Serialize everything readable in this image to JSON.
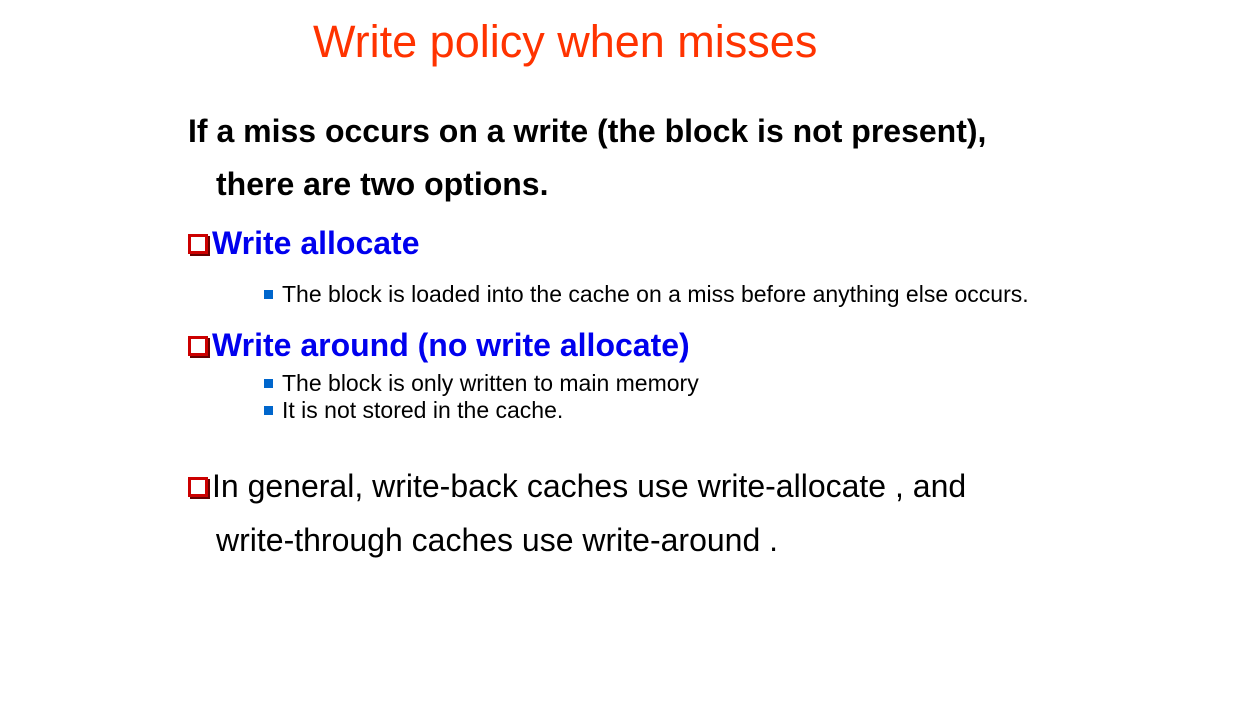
{
  "slide": {
    "title": "Write policy when misses",
    "intro": {
      "line1": "If a miss occurs on a write (the block is not present),",
      "line2": "there are two options."
    },
    "options": [
      {
        "label": "Write allocate",
        "details": [
          "The block is loaded into the cache on a miss before anything else occurs."
        ]
      },
      {
        "label": "Write around (no write allocate)",
        "details": [
          "The block is only written to main memory",
          "It is not stored in the cache."
        ]
      }
    ],
    "general": {
      "line1": "In general, write-back caches use write-allocate , and",
      "line2": "write-through caches use write-around ."
    },
    "colors": {
      "title": "#ff3300",
      "option_label": "#0000ee",
      "checkbox_border": "#cc0000",
      "sub_bullet": "#0066cc",
      "text": "#000000"
    }
  }
}
